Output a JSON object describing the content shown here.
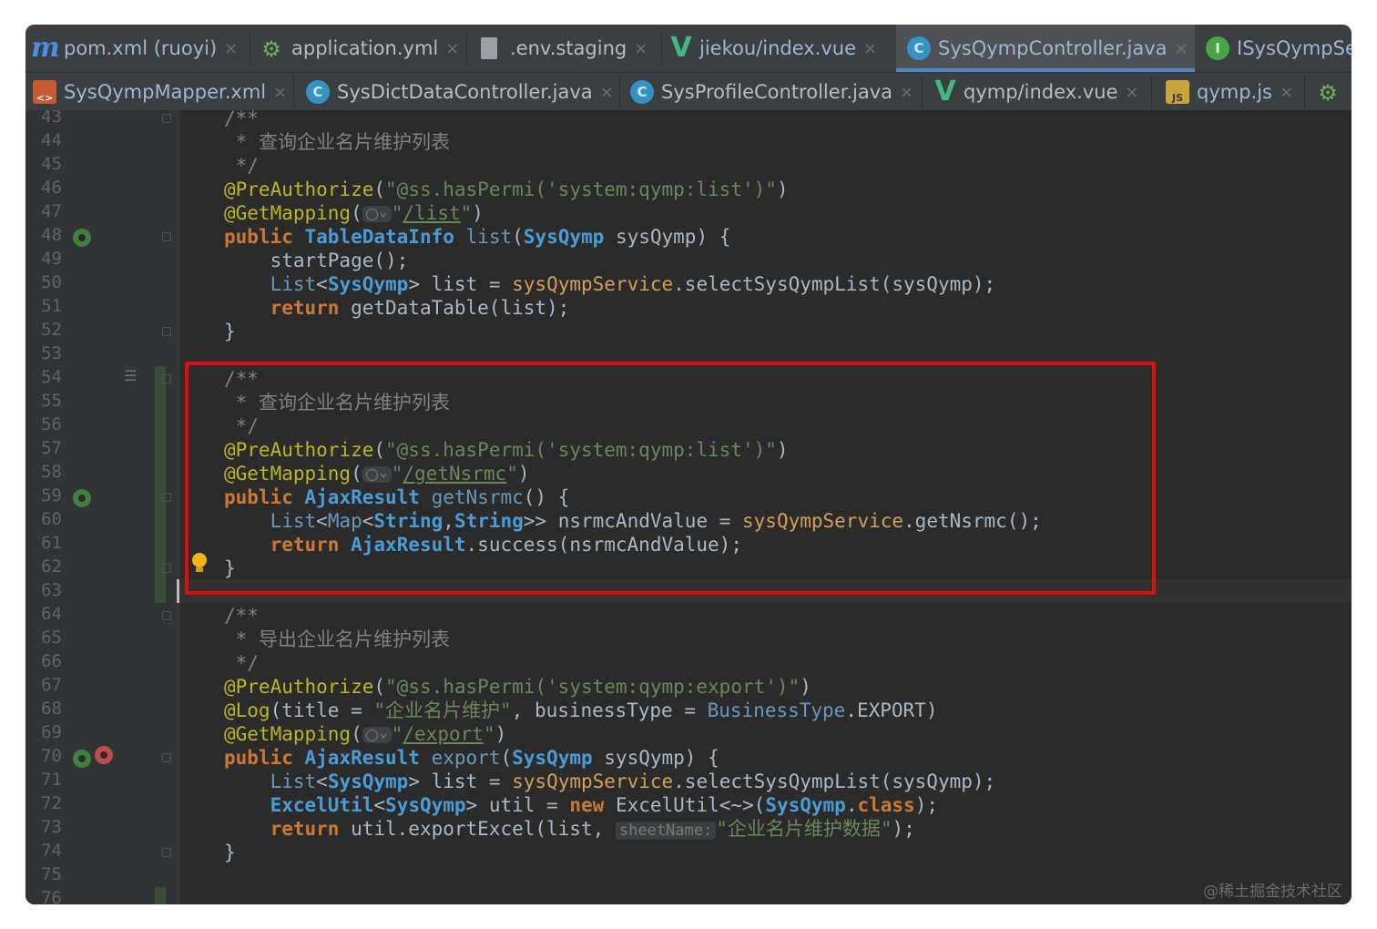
{
  "tabs_row1": [
    {
      "label": "pom.xml (ruoyi)",
      "icon": "maven-icon"
    },
    {
      "label": "application.yml",
      "icon": "yaml-config-icon"
    },
    {
      "label": ".env.staging",
      "icon": "text-file-icon"
    },
    {
      "label": "jiekou/index.vue",
      "icon": "vue-icon"
    },
    {
      "label": "SysQympController.java",
      "icon": "java-class-icon",
      "active": true
    },
    {
      "label": "ISysQympSe",
      "icon": "java-interface-icon"
    }
  ],
  "tabs_row2": [
    {
      "label": "SysQympMapper.xml",
      "icon": "xml-file-icon"
    },
    {
      "label": "SysDictDataController.java",
      "icon": "java-class-icon"
    },
    {
      "label": "SysProfileController.java",
      "icon": "java-class-icon"
    },
    {
      "label": "qymp/index.vue",
      "icon": "vue-icon"
    },
    {
      "label": "qymp.js",
      "icon": "js-file-icon"
    }
  ],
  "close_glyph": "×",
  "icon_glyphs": {
    "java_class": "C",
    "java_interface": "I",
    "vue": "V",
    "maven": "m",
    "yaml": "⚙",
    "xml": "<>",
    "js": "JS",
    "list": "☰"
  },
  "line_numbers": [
    "43",
    "44",
    "45",
    "46",
    "47",
    "48",
    "49",
    "50",
    "51",
    "52",
    "53",
    "54",
    "55",
    "56",
    "57",
    "58",
    "59",
    "60",
    "61",
    "62",
    "63",
    "64",
    "65",
    "66",
    "67",
    "68",
    "69",
    "70",
    "71",
    "72",
    "73",
    "74",
    "75",
    "76"
  ],
  "code": {
    "doc_open": "/**",
    "doc_close": "*/",
    "doc_star": "* ",
    "comment_list": "查询企业名片维护列表",
    "comment_export": "导出企业名片维护列表",
    "ann_preauthorize": "@PreAuthorize",
    "perm_list": "\"@ss.hasPermi('system:qymp:list')\"",
    "perm_export": "\"@ss.hasPermi('system:qymp:export')\"",
    "ann_getmapping": "@GetMapping",
    "ann_log": "@Log",
    "url_list": "/list",
    "url_getnsrmc": "/getNsrmc",
    "url_export": "/export",
    "kw_public": "public",
    "kw_return": "return",
    "kw_new": "new",
    "kw_class": "class",
    "type_tabledatainfo": "TableDataInfo",
    "type_ajaxresult": "AjaxResult",
    "type_sysqymp": "SysQymp",
    "type_list": "List",
    "type_map": "Map",
    "type_string": "String",
    "type_excelutil": "ExcelUtil",
    "fn_list": "list",
    "fn_getnsrmc": "getNsrmc",
    "fn_export": "export",
    "param_sysqymp": " sysQymp) {",
    "stmt_startpage": "startPage();",
    "var_list": " list = ",
    "service_field": "sysQympService",
    "call_selectlist": ".selectSysQympList(sysQymp);",
    "call_getdatatable": " getDataTable(list);",
    "brace_close": "}",
    "empty_parens_brace": "() {",
    "var_nsrmc": " nsrmcAndValue = ",
    "call_getnsrmc": ".getNsrmc();",
    "call_success": ".success(nsrmcAndValue);",
    "log_title_key": "(title = ",
    "log_title_val": "\"企业名片维护\"",
    "log_btype_key": ", businessType = ",
    "log_btype_cls": "BusinessType",
    "log_btype_val": ".EXPORT)",
    "var_util": " util = ",
    "excel_ctor": " ExcelUtil<~>(",
    "call_export": " util.exportExcel(list, ",
    "hint_sheetname": "sheetName:",
    "export_sheet_val": "\"企业名片维护数据\"",
    "end_stmt": ");"
  },
  "watermark": "@稀土掘金技术社区",
  "colors": {
    "highlight_box": "#e00d0d",
    "editor_bg": "#2b2b2b",
    "tab_accent": "#4a88c7"
  }
}
